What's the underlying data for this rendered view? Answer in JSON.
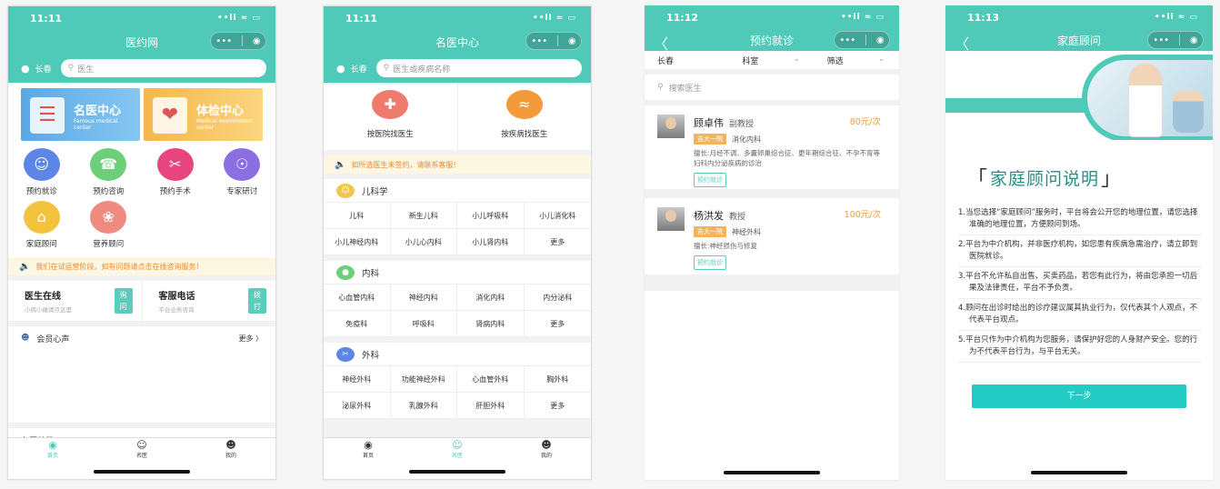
{
  "p1": {
    "status": {
      "time": "11:11",
      "icons": "••ll ≈ ▭"
    },
    "nav": {
      "title": "医约网"
    },
    "capsule": {
      "dots": "•••",
      "target": "◉"
    },
    "location": "长春",
    "search": {
      "placeholder": "医生"
    },
    "banners": [
      {
        "title": "名医中心",
        "sub1": "Famous medical",
        "sub2": "center"
      },
      {
        "title": "体检中心",
        "sub1": "Medical examination",
        "sub2": "center"
      }
    ],
    "grid": [
      {
        "label": "预约就诊",
        "color": "#5b86e5",
        "icon": "doctor-icon"
      },
      {
        "label": "预约咨询",
        "color": "#6ccf7a",
        "icon": "phone-icon"
      },
      {
        "label": "预约手术",
        "color": "#e8457f",
        "icon": "scissors-icon"
      },
      {
        "label": "专家研讨",
        "color": "#8b6fe0",
        "icon": "group-icon"
      },
      {
        "label": "家庭顾问",
        "color": "#f3c33d",
        "icon": "home-icon"
      },
      {
        "label": "营养顾问",
        "color": "#f08b82",
        "icon": "wheat-icon"
      }
    ],
    "notice": "我们在试运营阶段，如有问题请点击在线咨询服务！",
    "contacts": [
      {
        "title": "医生在线",
        "sub": "小病小痛请点这里",
        "btn1": "询",
        "btn2": "问"
      },
      {
        "title": "客服电话",
        "sub": "平台业务咨询",
        "btn1": "拨",
        "btn2": "打"
      }
    ],
    "voice": {
      "title": "会员心声",
      "more": "更多 〉"
    },
    "next_section": "名医荟萃",
    "tabs": [
      {
        "label": "首页"
      },
      {
        "label": "名医"
      },
      {
        "label": "我的"
      }
    ]
  },
  "p2": {
    "status": {
      "time": "11:11",
      "icons": "••ll ≈ ▭"
    },
    "nav": {
      "title": "名医中心"
    },
    "capsule": {
      "dots": "•••",
      "target": "◉"
    },
    "location": "长春",
    "search": {
      "placeholder": "医生或疾病名称"
    },
    "find": [
      {
        "label": "按医院找医生",
        "color": "#ef7a6e"
      },
      {
        "label": "按疾病找医生",
        "color": "#f39a3b"
      }
    ],
    "notice": "如所选医生未签约，请联系客服!",
    "depts": [
      {
        "name": "儿科学",
        "color": "#f2c64a",
        "cells": [
          "儿科",
          "新生儿科",
          "小儿呼吸科",
          "小儿消化科",
          "小儿神经内科",
          "小儿心内科",
          "小儿肾内科",
          "更多"
        ]
      },
      {
        "name": "内科",
        "color": "#6ccf7a",
        "cells": [
          "心血管内科",
          "神经内科",
          "消化内科",
          "内分泌科",
          "免疫科",
          "呼吸科",
          "肾病内科",
          "更多"
        ]
      },
      {
        "name": "外科",
        "color": "#5b86e5",
        "cells": [
          "神经外科",
          "功能神经外科",
          "心血管外科",
          "胸外科",
          "泌尿外科",
          "乳腺外科",
          "肝胆外科",
          "更多"
        ]
      }
    ],
    "tabs": [
      {
        "label": "首页"
      },
      {
        "label": "名医"
      },
      {
        "label": "我的"
      }
    ]
  },
  "p3": {
    "status": {
      "time": "11:12",
      "icons": "••ll ≈ ▭"
    },
    "nav": {
      "title": "预约就诊",
      "back": "〈"
    },
    "capsule": {
      "dots": "•••",
      "target": "◉"
    },
    "filters": [
      "长春",
      "科室",
      "筛选"
    ],
    "search": {
      "placeholder": "搜索医生"
    },
    "doctors": [
      {
        "name": "顾卓伟",
        "title": "副教授",
        "price": "80元/次",
        "hospital": "吉大一院",
        "dept": "消化内科",
        "desc": "擅长:月经不调、多囊卵巢综合征、更年期综合征、不孕不育等妇科内分泌疾病的诊治",
        "book": "预约就诊"
      },
      {
        "name": "杨洪发",
        "title": "教授",
        "price": "100元/次",
        "hospital": "吉大一院",
        "dept": "神经外科",
        "desc": "擅长:神经损伤与修复",
        "book": "预约就诊"
      }
    ]
  },
  "p4": {
    "status": {
      "time": "11:13",
      "icons": "••ll ≈ ▭"
    },
    "nav": {
      "title": "家庭顾问",
      "back": "〈"
    },
    "capsule": {
      "dots": "•••",
      "target": "◉"
    },
    "heading": "家庭顾问说明",
    "rules": [
      "1.当您选择“家庭顾问”服务时，平台将会公开您的地理位置，请您选择准确的地理位置，方便顾问到场。",
      "2.平台为中介机构，并非医疗机构，如您患有疾病急需治疗，请立即到医院就诊。",
      "3.平台不允许私自出售、买卖药品，若您有此行为，将由您承担一切后果及法律责任，平台不予负责。",
      "4.顾问在出诊时给出的诊疗建议属其执业行为，仅代表其个人观点，不代表平台观点。",
      "5.平台只作为中介机构为您服务，请保护好您的人身财产安全。您的行为不代表平台行为，与平台无关。"
    ],
    "next": "下一步"
  },
  "colors": {
    "accent": "#4fcab8",
    "price": "#f39a3b",
    "notice": "#e98b2a"
  }
}
